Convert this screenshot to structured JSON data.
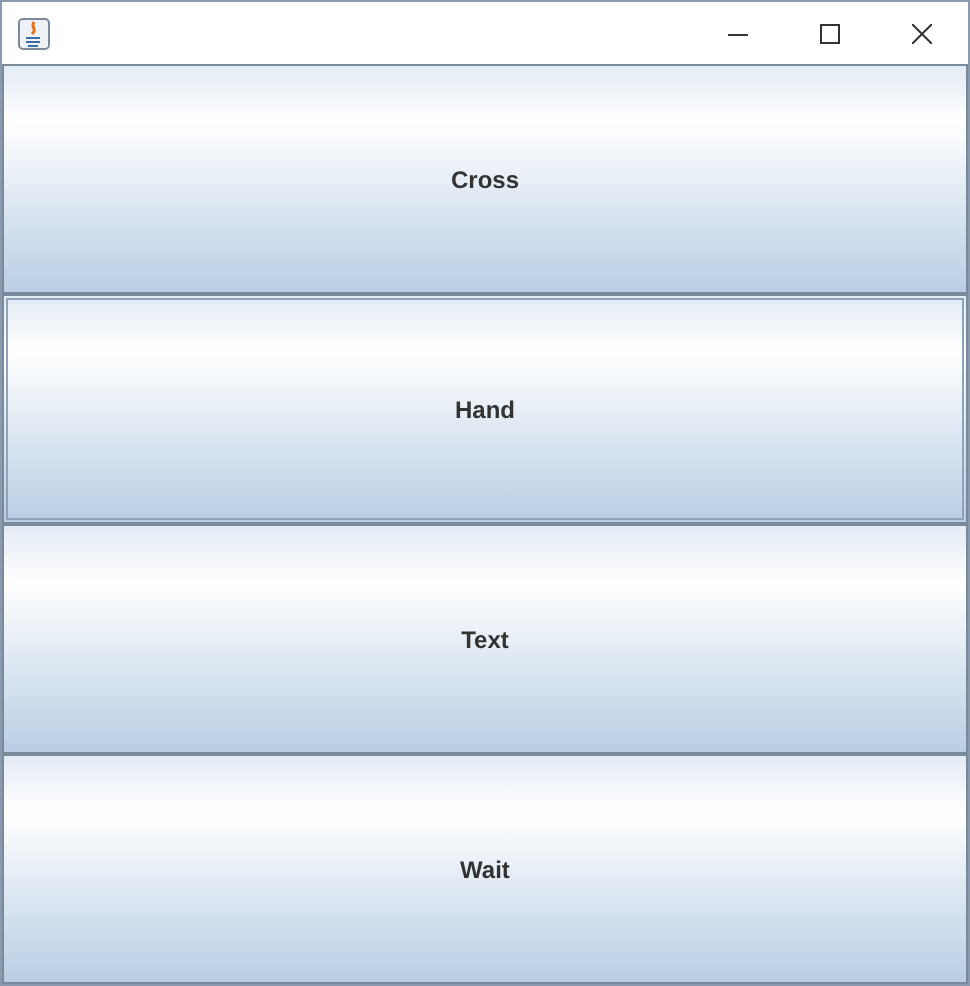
{
  "buttons": [
    {
      "label": "Cross",
      "focused": false
    },
    {
      "label": "Hand",
      "focused": true
    },
    {
      "label": "Text",
      "focused": false
    },
    {
      "label": "Wait",
      "focused": false
    }
  ]
}
